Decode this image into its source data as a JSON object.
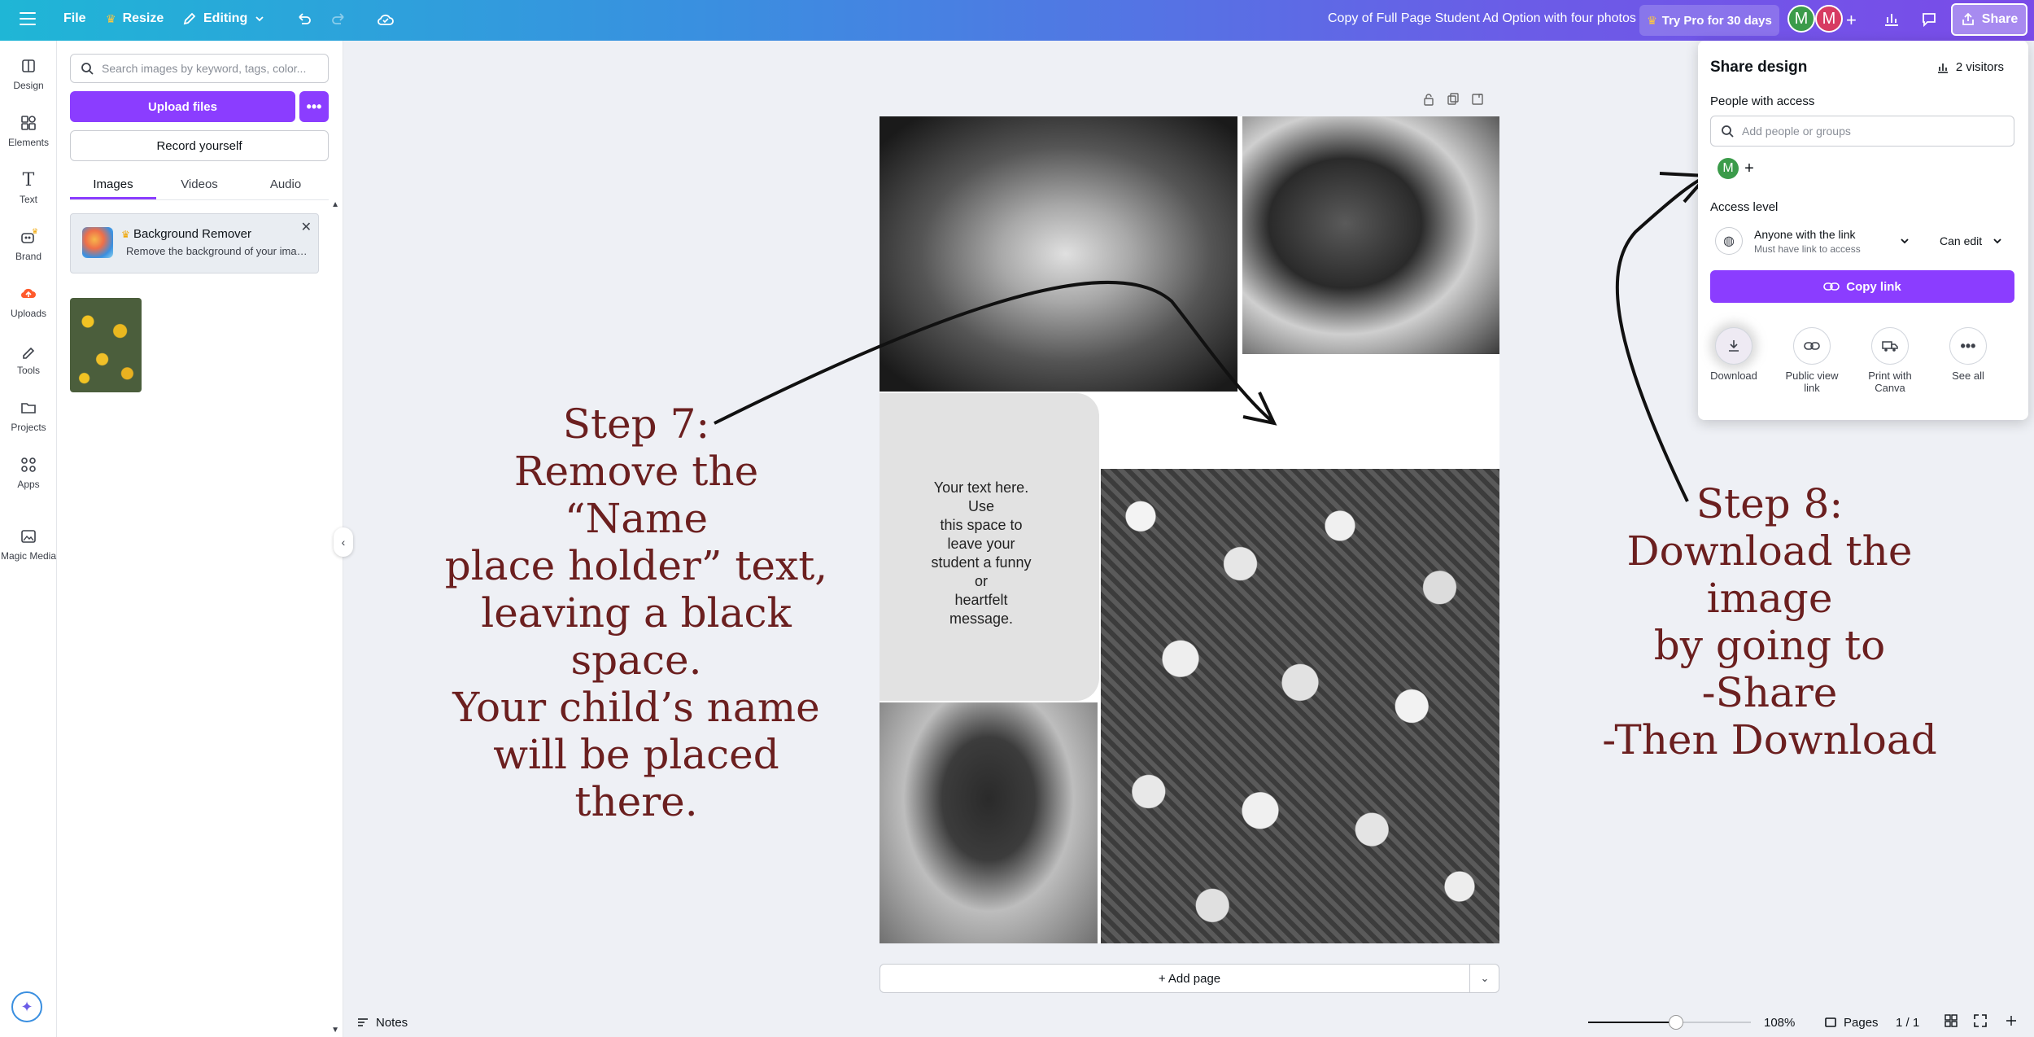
{
  "topbar": {
    "menu_icon": "hamburger-icon",
    "file": "File",
    "resize": "Resize",
    "editing": "Editing",
    "title": "Copy of Full Page Student Ad Option with four photos",
    "try_pro": "Try Pro for 30 days",
    "avatar1": "M",
    "avatar2": "M",
    "share": "Share",
    "colors": {
      "avatar1": "#3b9b4a",
      "avatar2": "#d73b62",
      "accent": "#8b3dff"
    }
  },
  "rail": {
    "items": [
      "Design",
      "Elements",
      "Text",
      "Brand",
      "Uploads",
      "Tools",
      "Projects",
      "Apps",
      "Magic Media"
    ]
  },
  "panel": {
    "search_placeholder": "Search images by keyword, tags, color...",
    "upload": "Upload files",
    "record": "Record yourself",
    "tabs": [
      "Images",
      "Videos",
      "Audio"
    ],
    "active_tab": "Images",
    "bg_remover_title": "Background Remover",
    "bg_remover_desc": "Remove the background of your imag..."
  },
  "canvas": {
    "textbox": "Your text here.\nUse\nthis space to\nleave your\nstudent a funny\nor\nheartfelt\nmessage.",
    "add_page": "+ Add page"
  },
  "annotations": {
    "step7": "Step 7:\nRemove the “Name\nplace holder” text,\nleaving a black space.\nYour child’s name\nwill be placed there.",
    "step8": "Step 8:\nDownload the image\nby going to\n-Share\n-Then Download"
  },
  "share_popover": {
    "title": "Share design",
    "visitors": "2 visitors",
    "people_with_access": "People with access",
    "add_placeholder": "Add people or groups",
    "avatar": "M",
    "access_level": "Access level",
    "access_option": "Anyone with the link",
    "access_sub": "Must have link to access",
    "permission": "Can edit",
    "copy_link": "Copy link",
    "actions": [
      "Download",
      "Public view link",
      "Print with Canva",
      "See all"
    ]
  },
  "bottombar": {
    "notes": "Notes",
    "zoom_level": 108,
    "zoom": "108%",
    "pages": "Pages",
    "page_count": "1 / 1"
  }
}
